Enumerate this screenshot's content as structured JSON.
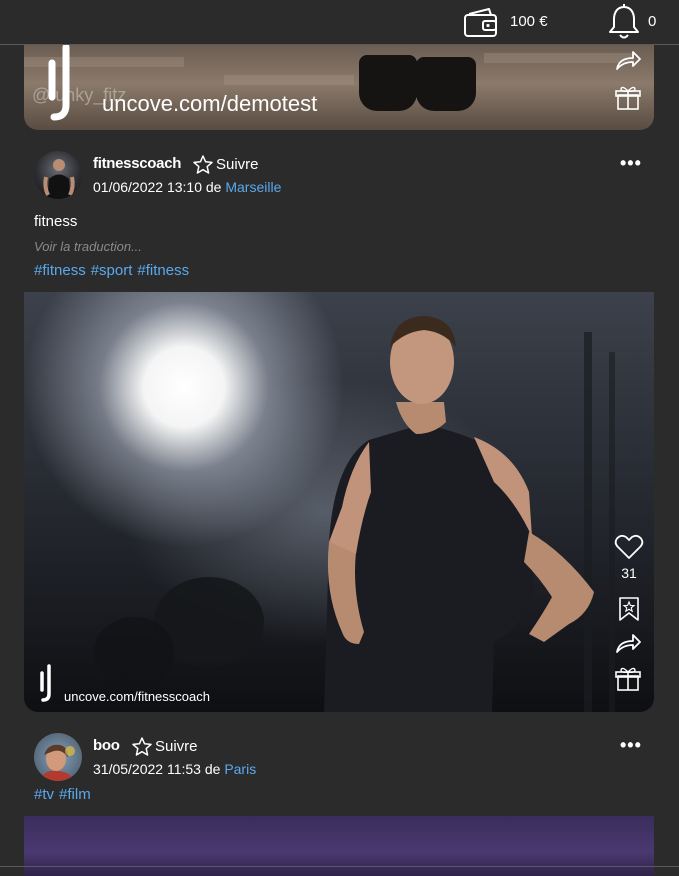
{
  "header": {
    "balance": "100 €",
    "notifications_count": "0"
  },
  "posts": [
    {
      "watermark_text": "uncove.com/demotest",
      "photo_overlay_text": "@funky_fitz"
    },
    {
      "username": "fitnesscoach",
      "follow_label": "Suivre",
      "date": "01/06/2022 13:10",
      "from_word": "de",
      "location": "Marseille",
      "caption": "fitness",
      "translate_label": "Voir la traduction...",
      "tags": [
        "#fitness",
        "#sport",
        "#fitness"
      ],
      "watermark_text": "uncove.com/fitnesscoach",
      "likes": "31",
      "more_label": "•••"
    },
    {
      "username": "boo",
      "follow_label": "Suivre",
      "date": "31/05/2022 11:53",
      "from_word": "de",
      "location": "Paris",
      "tags": [
        "#tv",
        "#film"
      ],
      "more_label": "•••"
    }
  ],
  "icons": [
    "wallet-icon",
    "bell-icon",
    "share-icon",
    "gift-icon",
    "heart-icon",
    "bookmark-icon",
    "star-icon",
    "more-icon",
    "uncove-logo-icon"
  ],
  "colors": {
    "background": "#2b2b2b",
    "link": "#5aa9ee",
    "muted": "#8a8a8a"
  }
}
